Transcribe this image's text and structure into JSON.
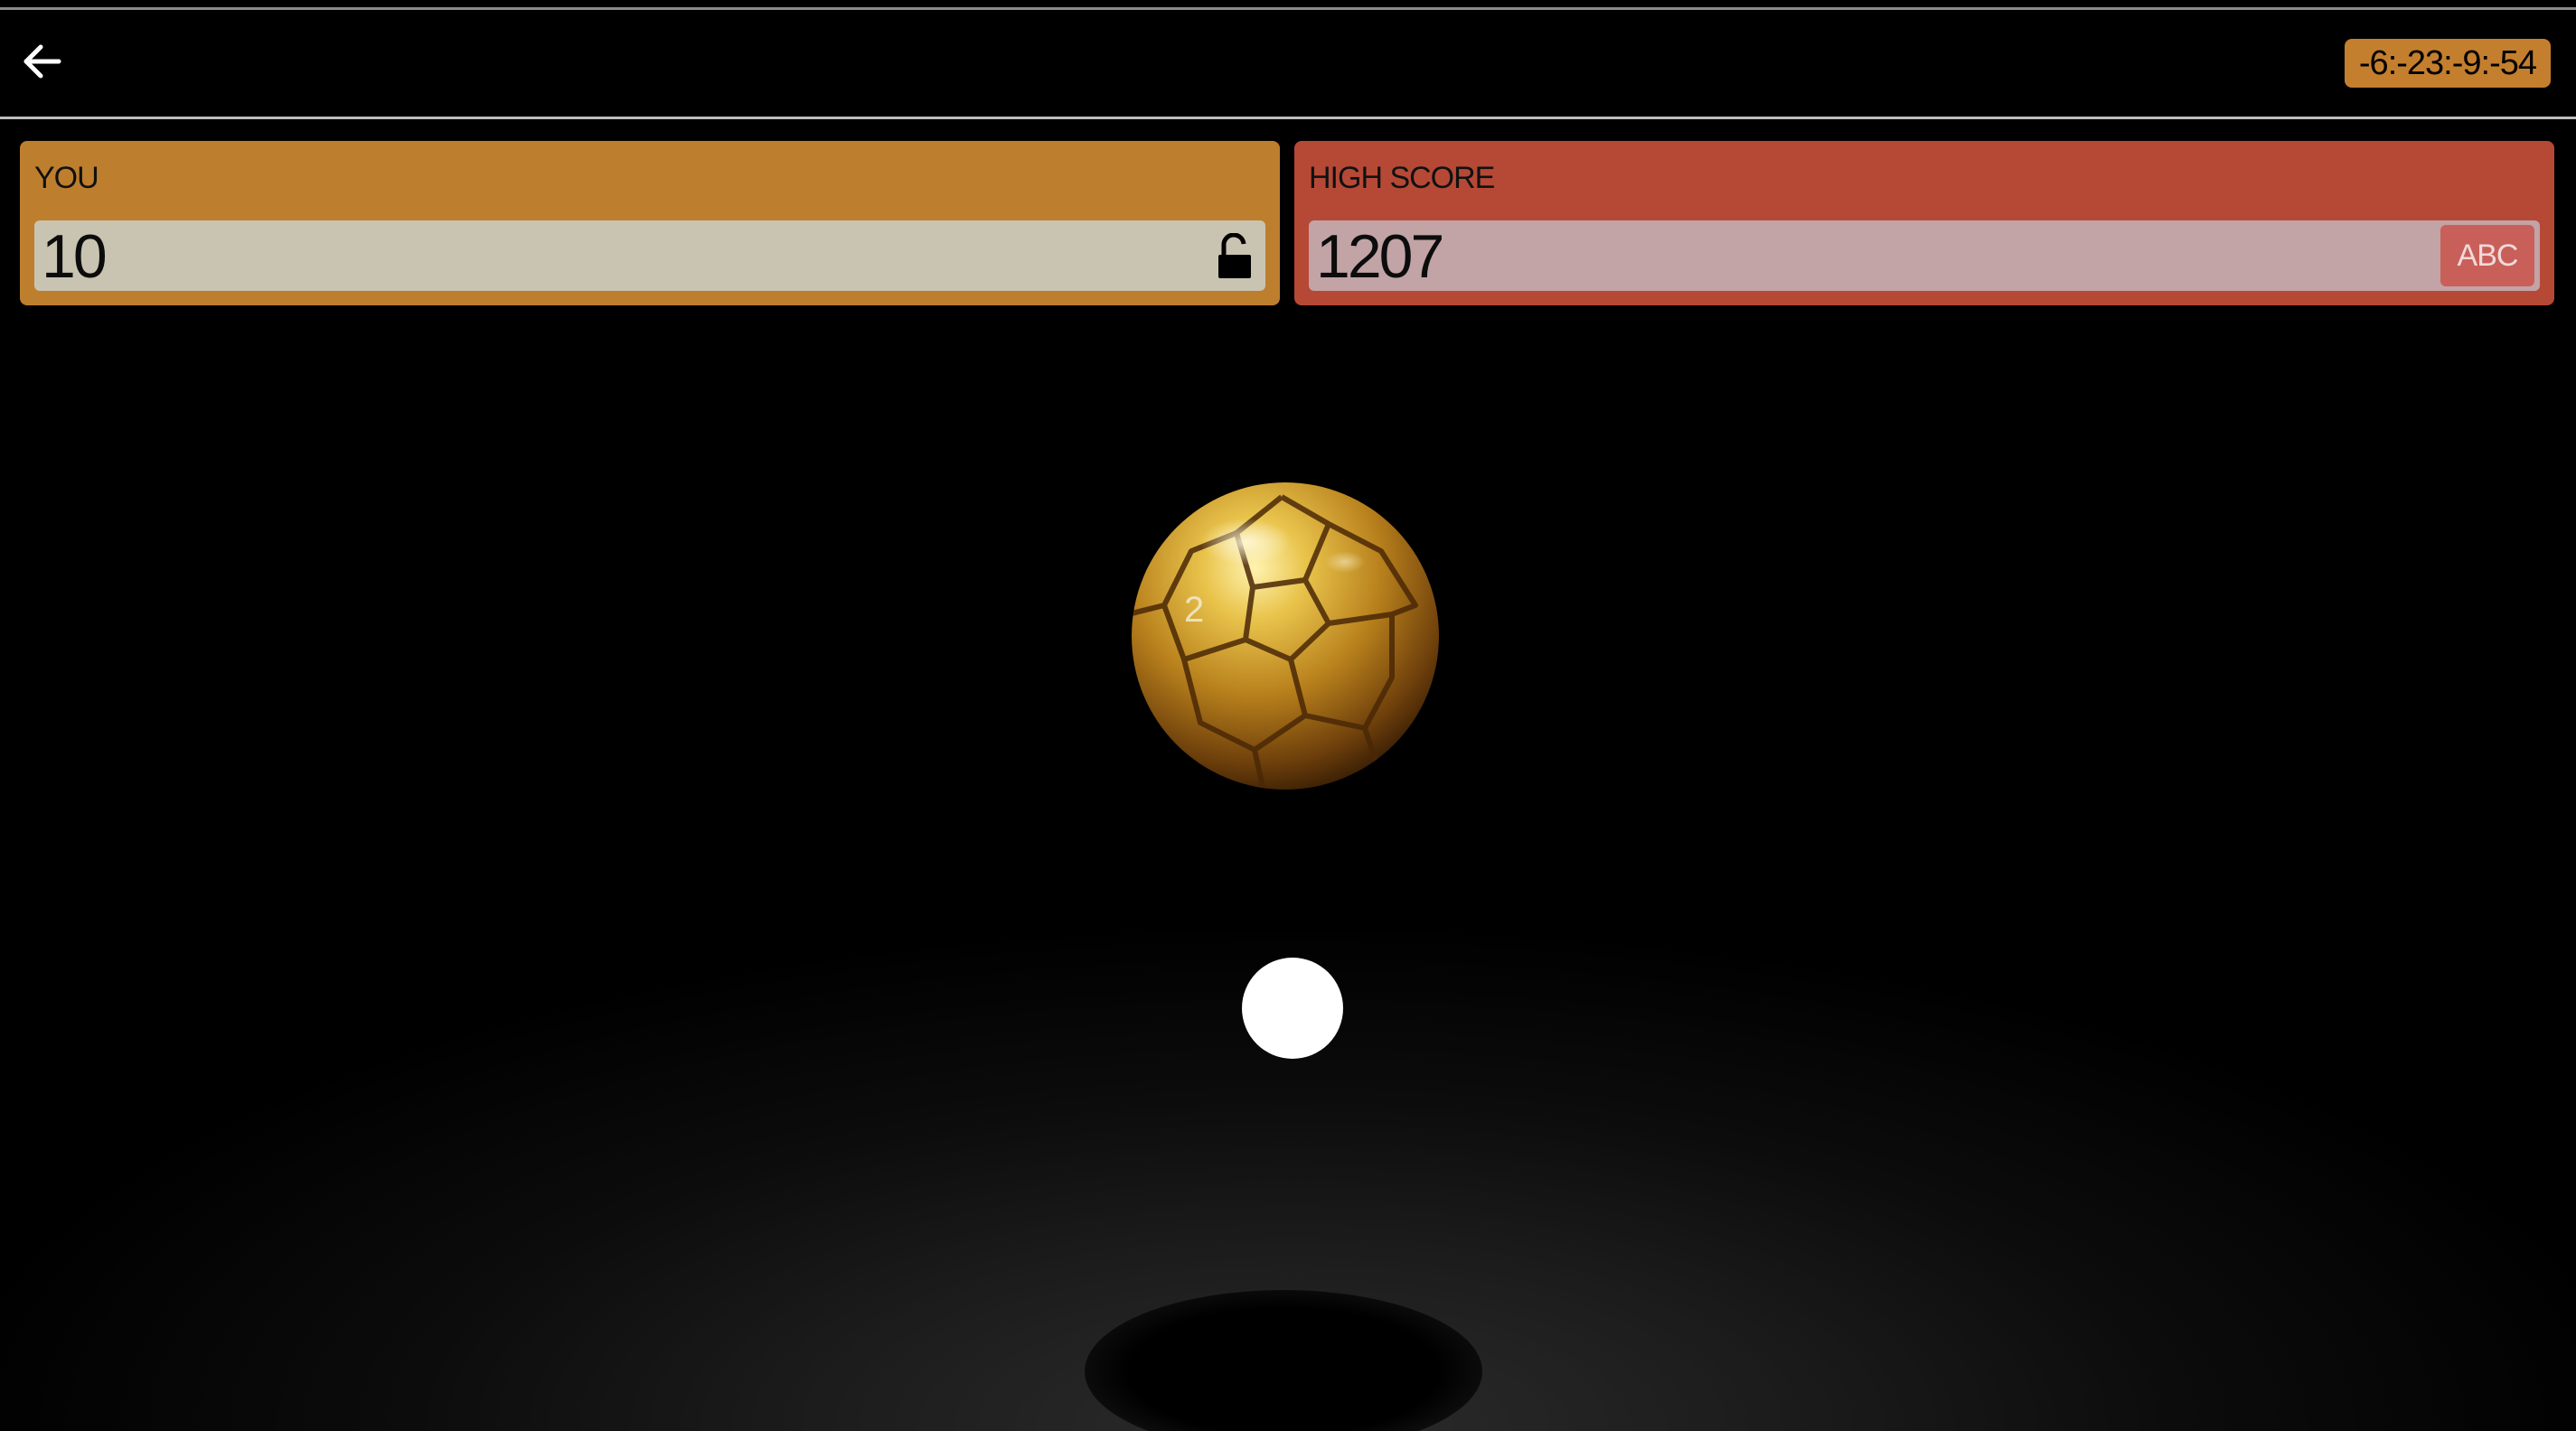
{
  "header": {
    "back_icon": "arrow-left-icon",
    "timer": "-6:-23:-9:-54"
  },
  "player_panel": {
    "label": "YOU",
    "score": "10",
    "icon": "lock-open-icon",
    "color": "#bd7e2e"
  },
  "high_score_panel": {
    "label": "HIGH SCORE",
    "score": "1207",
    "initials_button": "ABC",
    "color": "#b54936"
  },
  "game": {
    "ball": "gold-soccer-ball-icon",
    "ball_logo": "2",
    "target": "white-dot"
  },
  "colors": {
    "accent": "#c47f2e",
    "background": "#000000"
  }
}
